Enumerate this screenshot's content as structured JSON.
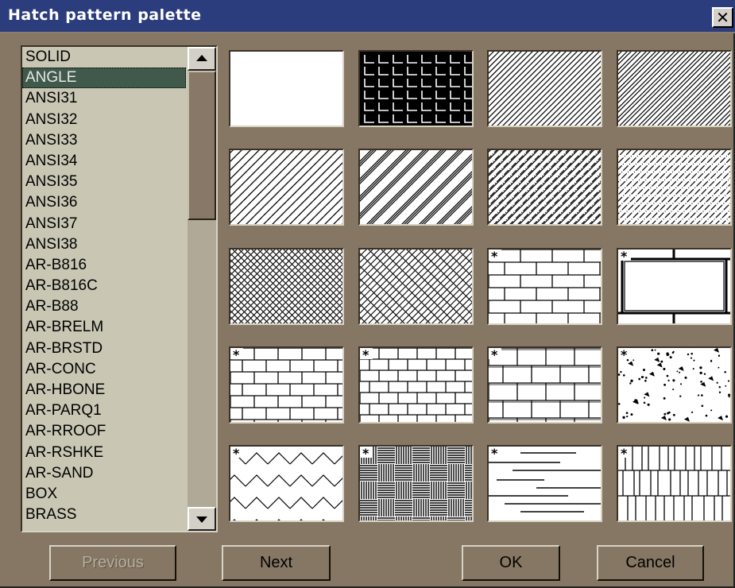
{
  "window": {
    "title": "Hatch pattern palette",
    "close_label": "✕"
  },
  "list": {
    "selected_index": 1,
    "items": [
      "SOLID",
      "ANGLE",
      "ANSI31",
      "ANSI32",
      "ANSI33",
      "ANSI34",
      "ANSI35",
      "ANSI36",
      "ANSI37",
      "ANSI38",
      "AR-B816",
      "AR-B816C",
      "AR-B88",
      "AR-BRELM",
      "AR-BRSTD",
      "AR-CONC",
      "AR-HBONE",
      "AR-PARQ1",
      "AR-RROOF",
      "AR-RSHKE",
      "AR-SAND",
      "BOX",
      "BRASS"
    ]
  },
  "scrollbar": {
    "up_icon": "arrow-up-icon",
    "down_icon": "arrow-down-icon"
  },
  "palette": {
    "patterns": [
      {
        "pattern": "solid",
        "marked": false
      },
      {
        "pattern": "angle",
        "marked": false
      },
      {
        "pattern": "ansi31",
        "marked": false
      },
      {
        "pattern": "ansi32",
        "marked": false
      },
      {
        "pattern": "ansi33",
        "marked": false
      },
      {
        "pattern": "ansi34",
        "marked": false
      },
      {
        "pattern": "ansi35",
        "marked": false
      },
      {
        "pattern": "ansi36",
        "marked": false
      },
      {
        "pattern": "ansi37",
        "marked": false
      },
      {
        "pattern": "ansi38",
        "marked": false
      },
      {
        "pattern": "ar-b816",
        "marked": true
      },
      {
        "pattern": "ar-b816c",
        "marked": true
      },
      {
        "pattern": "ar-b88",
        "marked": true
      },
      {
        "pattern": "ar-brelm",
        "marked": true
      },
      {
        "pattern": "ar-brstd",
        "marked": true
      },
      {
        "pattern": "ar-conc",
        "marked": true
      },
      {
        "pattern": "ar-hbone",
        "marked": true
      },
      {
        "pattern": "ar-parq1",
        "marked": true
      },
      {
        "pattern": "ar-rroof",
        "marked": true
      },
      {
        "pattern": "ar-rshke",
        "marked": true
      }
    ],
    "marker_text": "*"
  },
  "buttons": {
    "previous": "Previous",
    "next": "Next",
    "ok": "OK",
    "cancel": "Cancel",
    "previous_enabled": false
  }
}
